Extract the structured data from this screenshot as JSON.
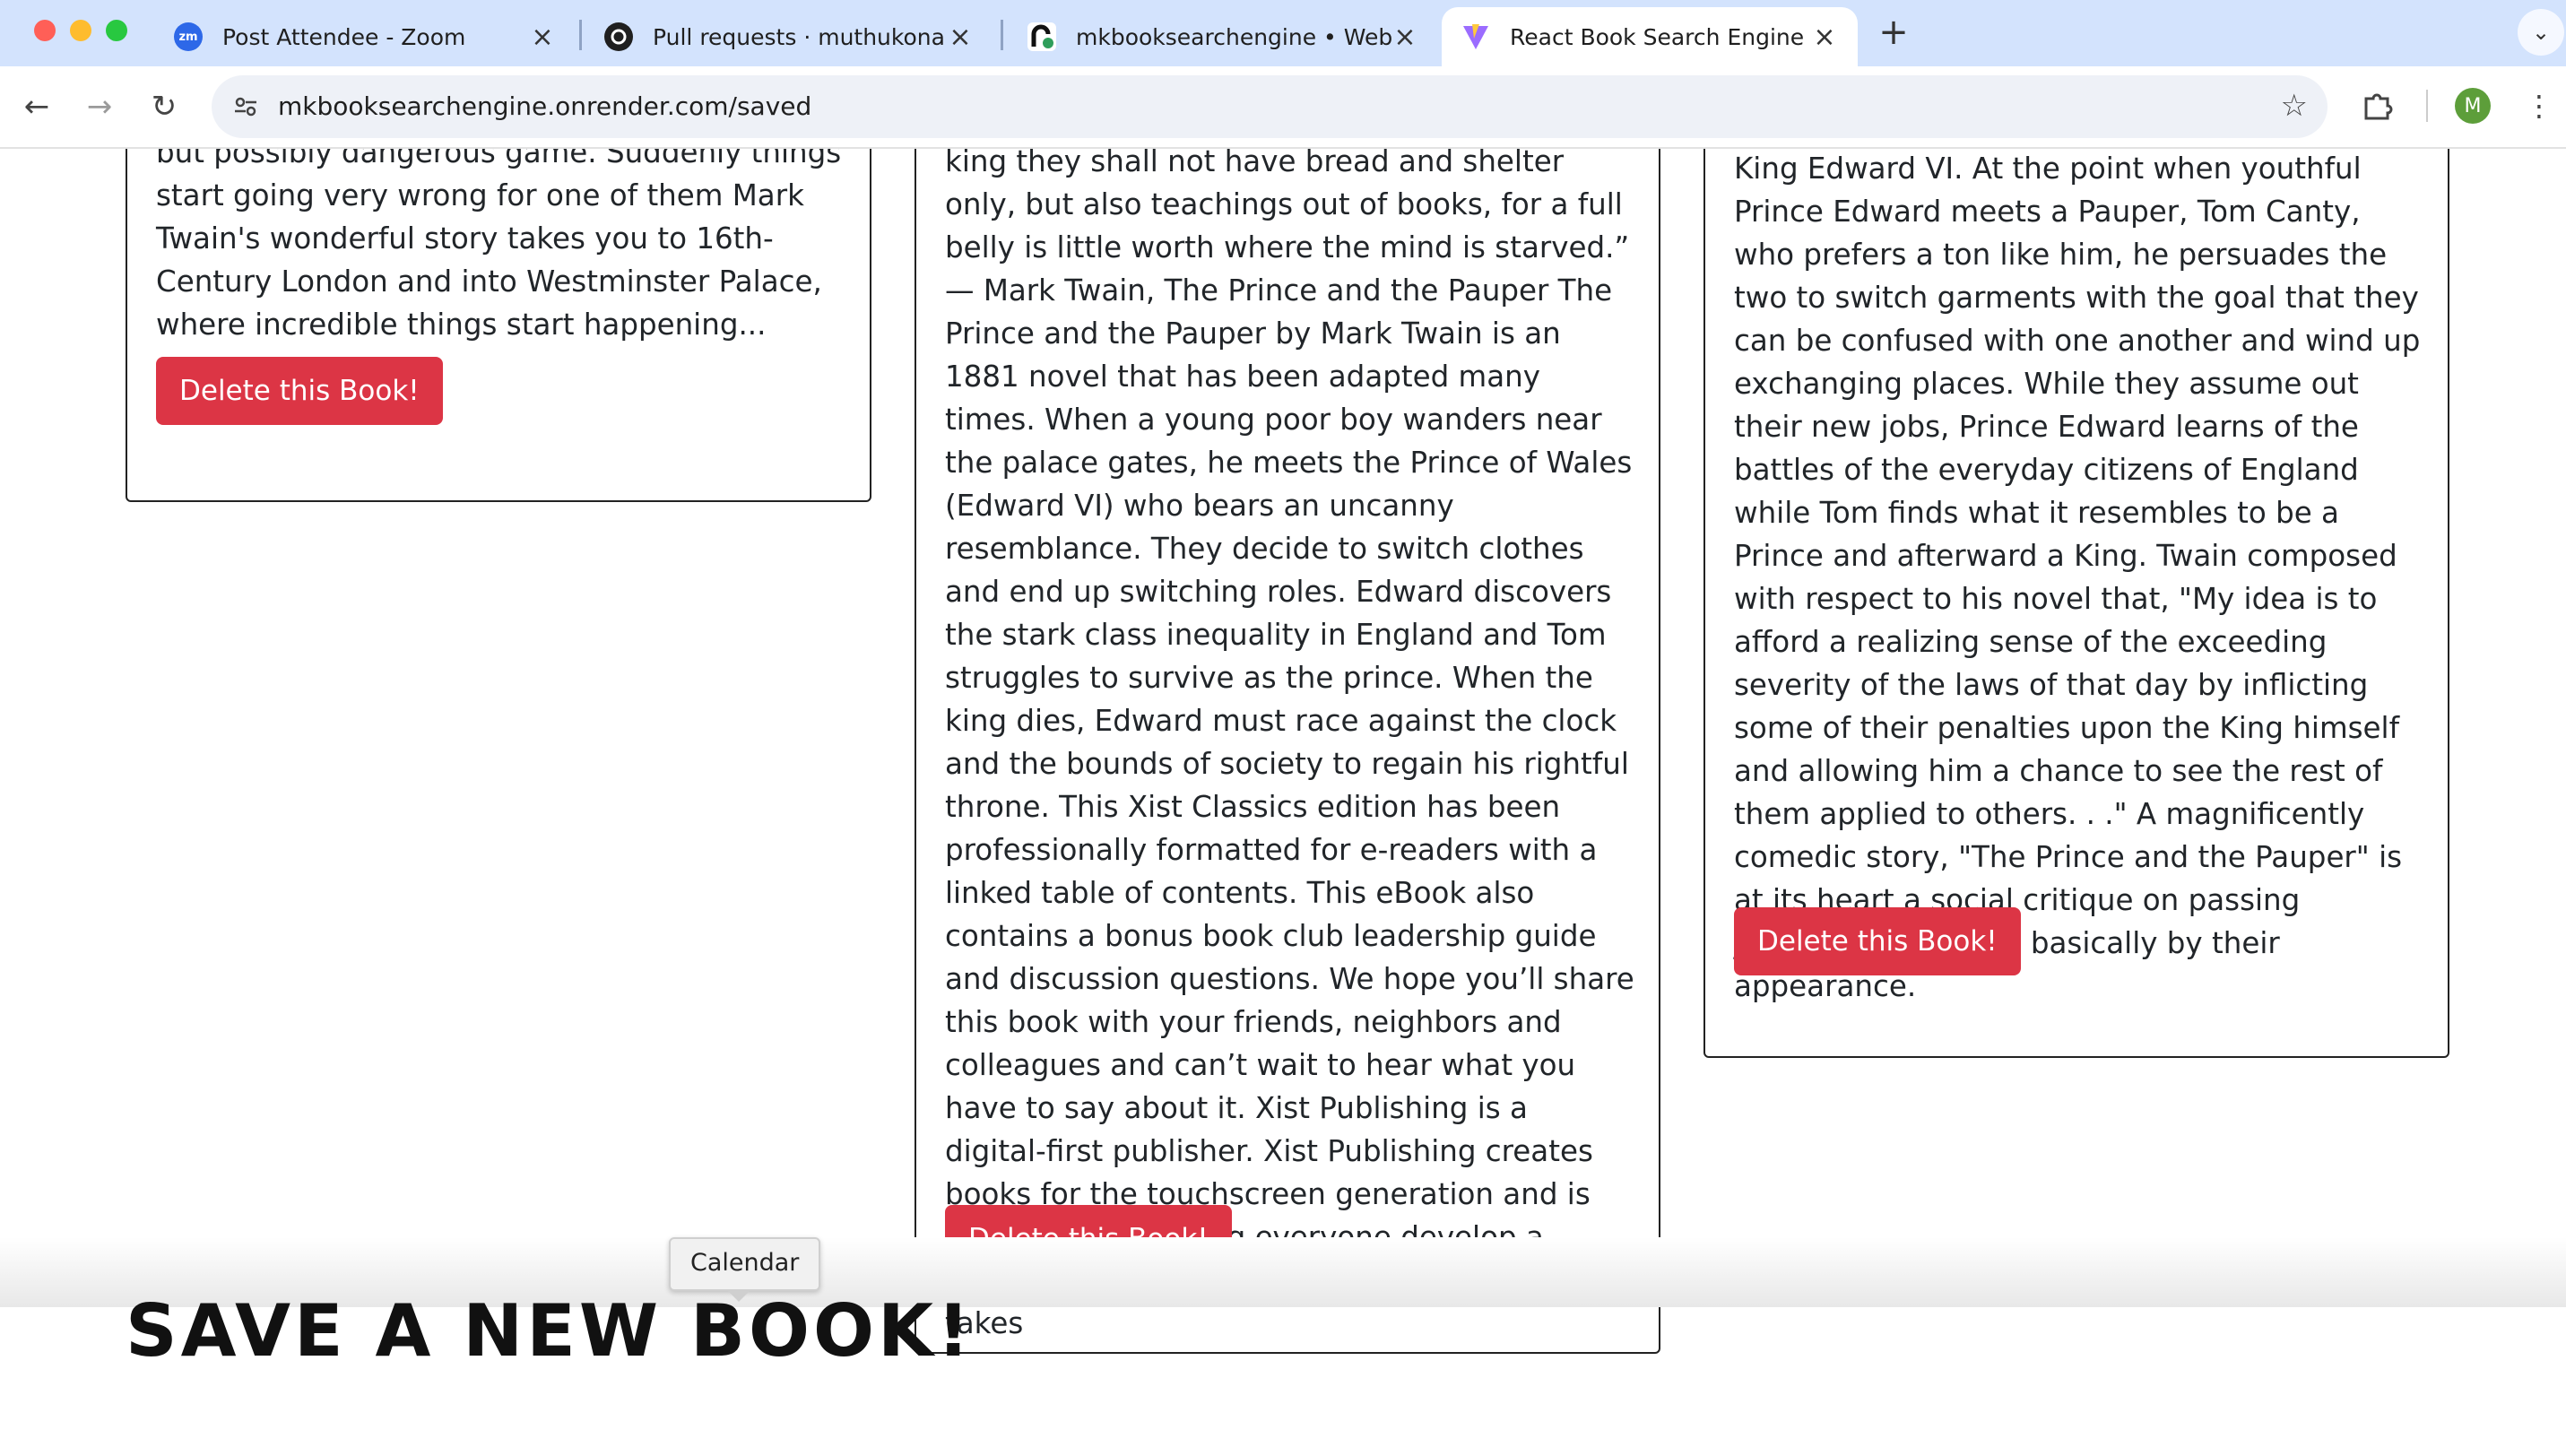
{
  "browser": {
    "tabs": [
      {
        "title": "Post Attendee - Zoom",
        "favicon": "zoom-icon",
        "favicon_text": "zm"
      },
      {
        "title": "Pull requests · muthukonar/W",
        "favicon": "github-icon"
      },
      {
        "title": "mkbooksearchengine • Web",
        "favicon": "render-icon"
      },
      {
        "title": "React Book Search Engine",
        "favicon": "vite-icon",
        "active": true
      }
    ],
    "new_tab": "+",
    "tab_menu_icon": "chevron-down-icon",
    "url": "mkbooksearchengine.onrender.com/saved",
    "profile_initial": "M",
    "colors": {
      "tabstrip": "#d3e3fd",
      "omnibox": "#eef1f7",
      "profile": "#5d9e3a"
    }
  },
  "page": {
    "cards": [
      {
        "description": "but possibly dangerous game. Suddenly things start going very wrong for one of them Mark Twain's wonderful story takes you to 16th-Century London and into Westminster Palace, where incredible things start happening...",
        "delete_label": "Delete this Book!"
      },
      {
        "description": "king they shall not have bread and shelter only, but also teachings out of books, for a full belly is little worth where the mind is starved.” — Mark Twain, The Prince and the Pauper The Prince and the Pauper by Mark Twain is an 1881 novel that has been adapted many times. When a young poor boy wanders near the palace gates, he meets the Prince of Wales (Edward VI) who bears an uncanny resemblance. They decide to switch clothes and end up switching roles. Edward discovers the stark class inequality in England and Tom struggles to survive as the prince. When the king dies, Edward must race against the clock and the bounds of society to regain his rightful throne. This Xist Classics edition has been professionally formatted for e-readers with a linked table of contents. This eBook also contains a bonus book club leadership guide and discussion questions. We hope you’ll share this book with your friends, neighbors and colleagues and can’t wait to hear what you have to say about it. Xist Publishing is a digital-first publisher. Xist Publishing creates books for the touchscreen generation and is dedicated to helping everyone develop a lifetime love of reading, no matter what form it takes",
        "delete_label": "Delete this Book!"
      },
      {
        "description": "King Edward VI. At the point when youthful Prince Edward meets a Pauper, Tom Canty, who prefers a ton like him, he persuades the two to switch garments with the goal that they can be confused with one another and wind up exchanging places. While they assume out their new jobs, Prince Edward learns of the battles of the everyday citizens of England while Tom finds what it resembles to be a Prince and afterward a King. Twain composed with respect to his novel that, \"My idea is to afford a realizing sense of the exceeding severity of the laws of that day by inflicting some of their penalties upon the King himself and allowing him a chance to see the rest of them applied to others. . .\" A magnificently comedic story, \"The Prince and the Pauper\" is at its heart a social critique on passing judgment on others basically by their appearance.",
        "delete_label": "Delete this Book!"
      }
    ],
    "delete_color": "#dc3545",
    "bottom_heading": "SAVE A NEW BOOK!",
    "tooltip": "Calendar"
  }
}
